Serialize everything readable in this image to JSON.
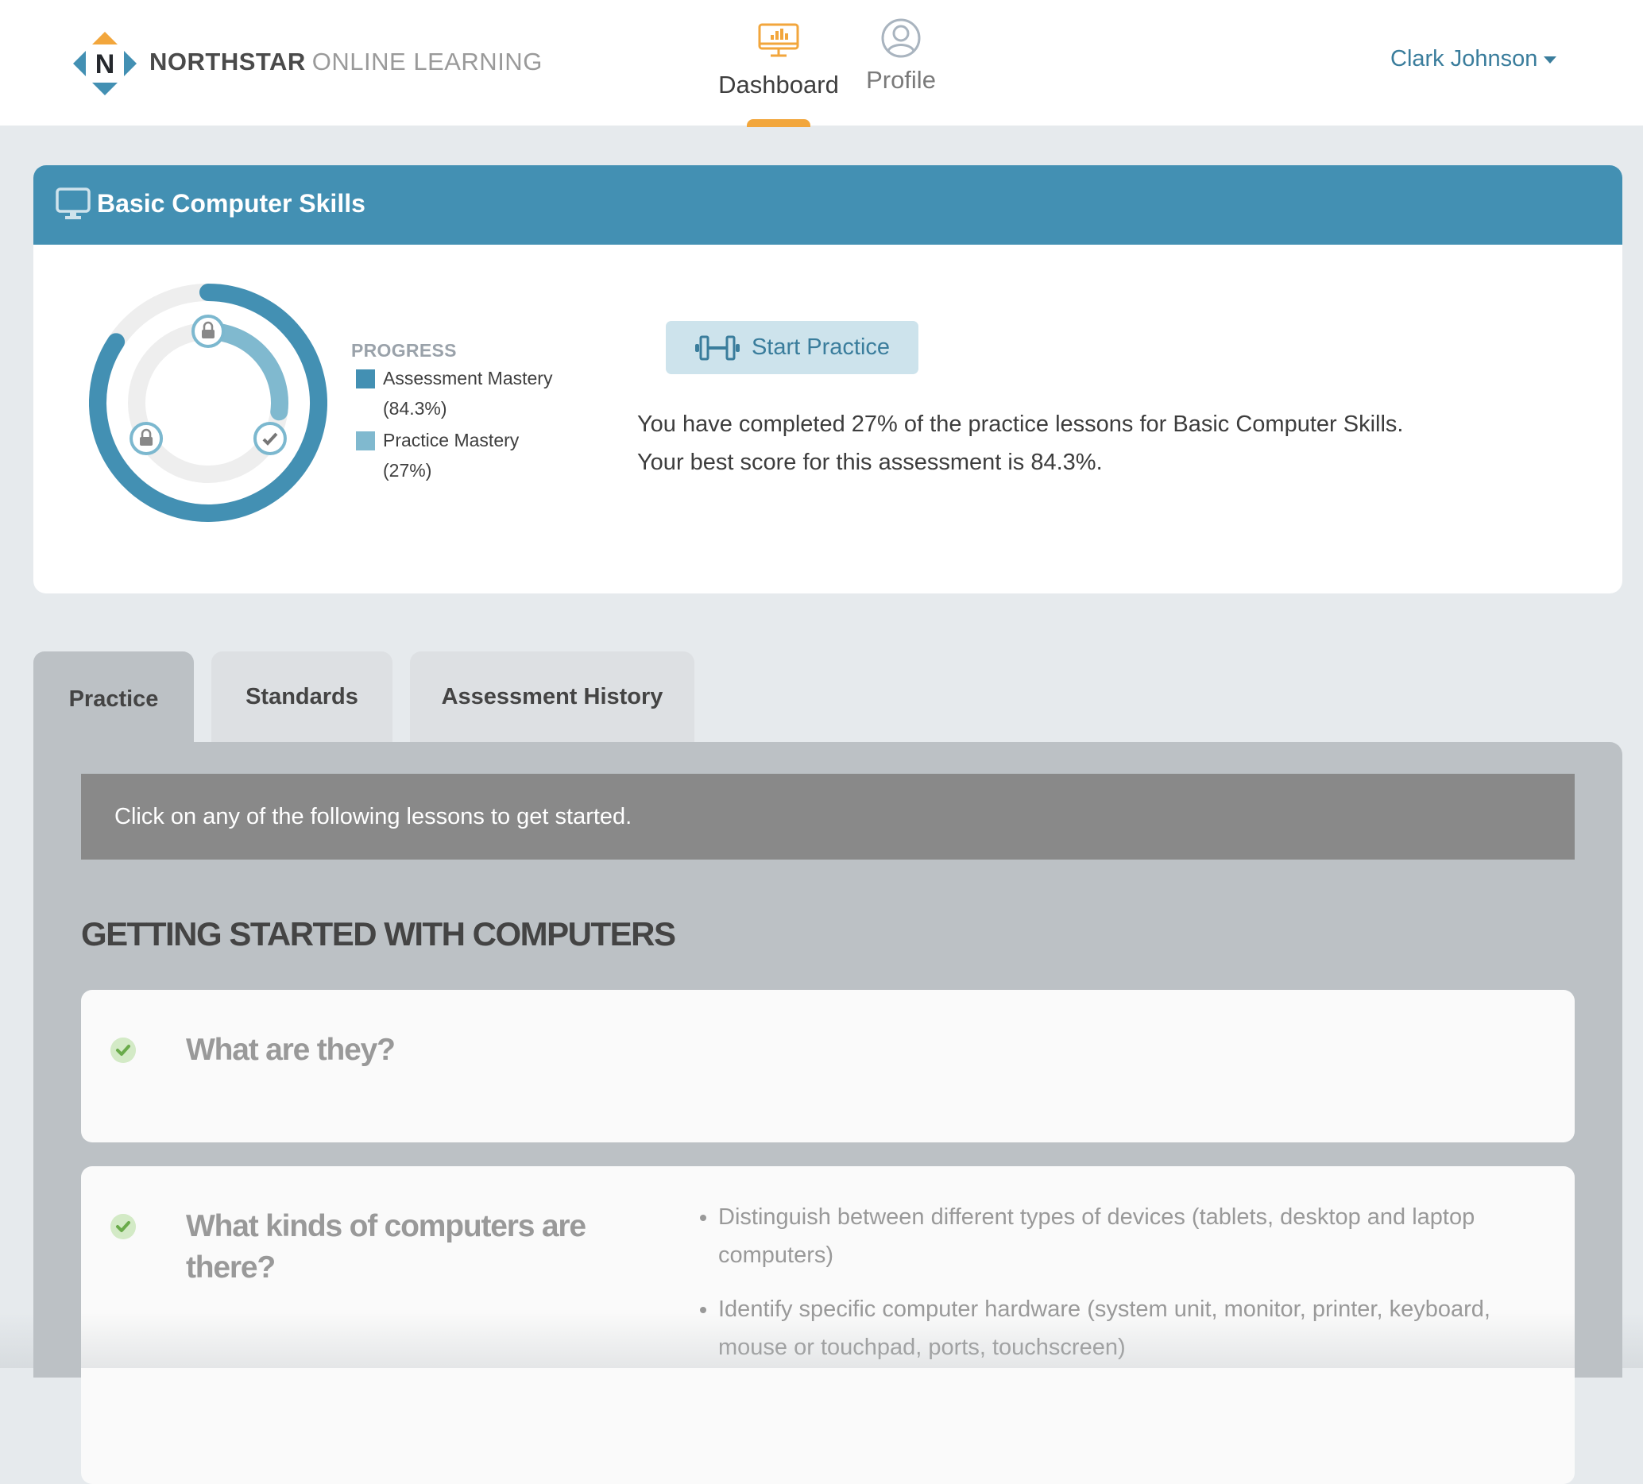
{
  "header": {
    "brand_bold": "NORTHSTAR",
    "brand_light": "ONLINE LEARNING",
    "logo_letter": "N",
    "nav": [
      {
        "label": "Dashboard",
        "icon": "monitor-chart-icon",
        "active": true
      },
      {
        "label": "Profile",
        "icon": "user-circle-icon",
        "active": false
      }
    ],
    "user_name": "Clark Johnson"
  },
  "colors": {
    "brand_blue": "#4390b3",
    "practice_blue": "#80b9cf",
    "accent_orange": "#f2a63c",
    "link_blue": "#3a7d9c",
    "success_green": "#6aab4b"
  },
  "course": {
    "title": "Basic Computer Skills",
    "icon": "monitor-icon",
    "progress_label": "PROGRESS",
    "legend": [
      {
        "label": "Assessment Mastery",
        "value": "(84.3%)"
      },
      {
        "label": "Practice Mastery",
        "value": "(27%)"
      }
    ],
    "start_practice_label": "Start Practice",
    "summary_line1": "You have completed 27% of the practice lessons for Basic Computer Skills.",
    "summary_line2": "Your best score for this assessment is 84.3%."
  },
  "chart_data": {
    "type": "pie",
    "title": "PROGRESS",
    "series": [
      {
        "name": "Assessment Mastery",
        "value": 84.3,
        "unit": "%"
      },
      {
        "name": "Practice Mastery",
        "value": 27,
        "unit": "%"
      }
    ],
    "milestones": [
      {
        "status": "completed",
        "icon": "check-icon"
      },
      {
        "status": "locked",
        "icon": "lock-icon"
      },
      {
        "status": "locked",
        "icon": "lock-icon"
      }
    ]
  },
  "tabs": [
    {
      "label": "Practice",
      "active": true
    },
    {
      "label": "Standards",
      "active": false
    },
    {
      "label": "Assessment History",
      "active": false
    }
  ],
  "practice": {
    "banner": "Click on any of the following lessons to get started.",
    "section_title": "GETTING STARTED WITH COMPUTERS",
    "lessons": [
      {
        "title": "What are they?",
        "completed": true,
        "objectives": []
      },
      {
        "title": "What kinds of computers are there?",
        "completed": true,
        "objectives": [
          "Distinguish between different types of devices (tablets, desktop and laptop computers)",
          "Identify specific computer hardware (system unit, monitor, printer, keyboard, mouse or touchpad, ports, touchscreen)"
        ]
      }
    ]
  }
}
